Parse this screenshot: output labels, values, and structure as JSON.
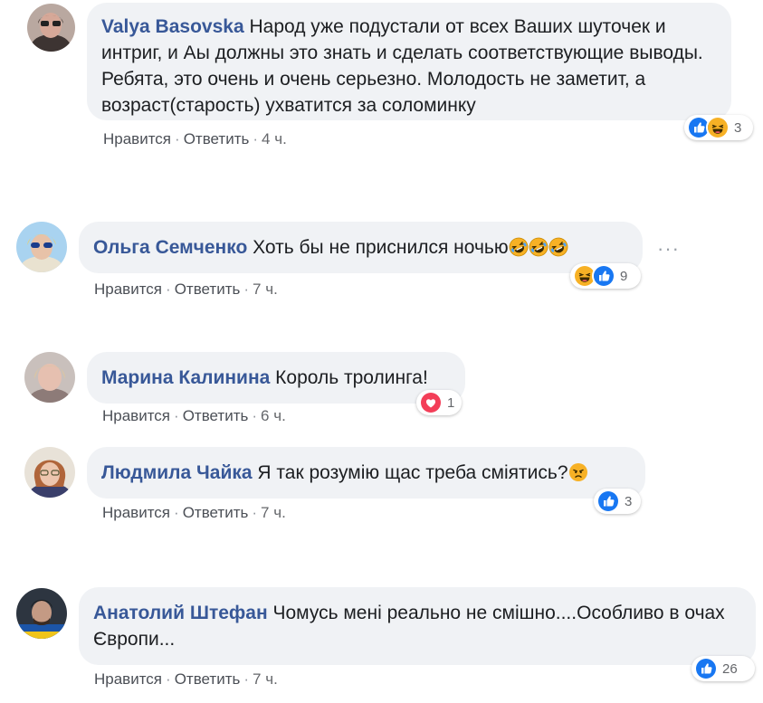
{
  "comments": [
    {
      "author": "Valya Basovska",
      "text": "Народ уже подустали от всех Ваших шуточек и интриг, и Аы должны это знать и сделать соответствующие выводы. Ребята, это очень и очень серьезно. Молодость не заметит, а возраст(старость) ухватится за соломинку",
      "like_label": "Нравится",
      "reply_label": "Ответить",
      "time": "4 ч.",
      "reactions": [
        "like-icon",
        "haha-icon"
      ],
      "reaction_count": "3"
    },
    {
      "author": "Ольга Семченко",
      "text": "Хоть бы не приснился ночью",
      "inline_emojis": [
        "rofl-icon",
        "rofl-icon",
        "rofl-icon"
      ],
      "like_label": "Нравится",
      "reply_label": "Ответить",
      "time": "7 ч.",
      "reactions": [
        "haha-icon",
        "like-icon"
      ],
      "reaction_count": "9",
      "more_label": "···"
    },
    {
      "author": "Марина Калинина",
      "text": "Король тролинга!",
      "like_label": "Нравится",
      "reply_label": "Ответить",
      "time": "6 ч.",
      "reactions": [
        "love-icon"
      ],
      "reaction_count": "1"
    },
    {
      "author": "Людмила Чайка",
      "text": "Я так розумію щас треба сміятись?",
      "inline_emojis": [
        "angry-face-icon"
      ],
      "like_label": "Нравится",
      "reply_label": "Ответить",
      "time": "7 ч.",
      "reactions": [
        "like-icon"
      ],
      "reaction_count": "3"
    },
    {
      "author": "Анатолий Штефан",
      "text": "Чомусь мені реально не смішно....Особливо в очах Європи...",
      "like_label": "Нравится",
      "reply_label": "Ответить",
      "time": "7 ч.",
      "reactions": [
        "like-icon"
      ],
      "reaction_count": "26"
    }
  ],
  "colors": {
    "bubble": "#f0f2f5",
    "author": "#385898",
    "like_blue": "#1877f2",
    "love_red": "#f33e58",
    "haha_yellow": "#f7b125"
  }
}
